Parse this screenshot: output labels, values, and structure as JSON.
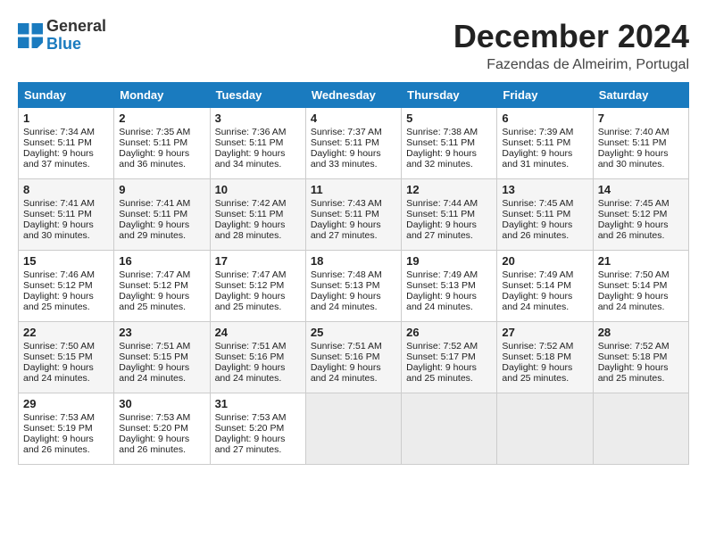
{
  "header": {
    "logo_line1": "General",
    "logo_line2": "Blue",
    "month": "December 2024",
    "location": "Fazendas de Almeirim, Portugal"
  },
  "days_of_week": [
    "Sunday",
    "Monday",
    "Tuesday",
    "Wednesday",
    "Thursday",
    "Friday",
    "Saturday"
  ],
  "weeks": [
    [
      {
        "day": 1,
        "sunrise": "7:34 AM",
        "sunset": "5:11 PM",
        "daylight": "9 hours and 37 minutes."
      },
      {
        "day": 2,
        "sunrise": "7:35 AM",
        "sunset": "5:11 PM",
        "daylight": "9 hours and 36 minutes."
      },
      {
        "day": 3,
        "sunrise": "7:36 AM",
        "sunset": "5:11 PM",
        "daylight": "9 hours and 34 minutes."
      },
      {
        "day": 4,
        "sunrise": "7:37 AM",
        "sunset": "5:11 PM",
        "daylight": "9 hours and 33 minutes."
      },
      {
        "day": 5,
        "sunrise": "7:38 AM",
        "sunset": "5:11 PM",
        "daylight": "9 hours and 32 minutes."
      },
      {
        "day": 6,
        "sunrise": "7:39 AM",
        "sunset": "5:11 PM",
        "daylight": "9 hours and 31 minutes."
      },
      {
        "day": 7,
        "sunrise": "7:40 AM",
        "sunset": "5:11 PM",
        "daylight": "9 hours and 30 minutes."
      }
    ],
    [
      {
        "day": 8,
        "sunrise": "7:41 AM",
        "sunset": "5:11 PM",
        "daylight": "9 hours and 30 minutes."
      },
      {
        "day": 9,
        "sunrise": "7:41 AM",
        "sunset": "5:11 PM",
        "daylight": "9 hours and 29 minutes."
      },
      {
        "day": 10,
        "sunrise": "7:42 AM",
        "sunset": "5:11 PM",
        "daylight": "9 hours and 28 minutes."
      },
      {
        "day": 11,
        "sunrise": "7:43 AM",
        "sunset": "5:11 PM",
        "daylight": "9 hours and 27 minutes."
      },
      {
        "day": 12,
        "sunrise": "7:44 AM",
        "sunset": "5:11 PM",
        "daylight": "9 hours and 27 minutes."
      },
      {
        "day": 13,
        "sunrise": "7:45 AM",
        "sunset": "5:11 PM",
        "daylight": "9 hours and 26 minutes."
      },
      {
        "day": 14,
        "sunrise": "7:45 AM",
        "sunset": "5:12 PM",
        "daylight": "9 hours and 26 minutes."
      }
    ],
    [
      {
        "day": 15,
        "sunrise": "7:46 AM",
        "sunset": "5:12 PM",
        "daylight": "9 hours and 25 minutes."
      },
      {
        "day": 16,
        "sunrise": "7:47 AM",
        "sunset": "5:12 PM",
        "daylight": "9 hours and 25 minutes."
      },
      {
        "day": 17,
        "sunrise": "7:47 AM",
        "sunset": "5:12 PM",
        "daylight": "9 hours and 25 minutes."
      },
      {
        "day": 18,
        "sunrise": "7:48 AM",
        "sunset": "5:13 PM",
        "daylight": "9 hours and 24 minutes."
      },
      {
        "day": 19,
        "sunrise": "7:49 AM",
        "sunset": "5:13 PM",
        "daylight": "9 hours and 24 minutes."
      },
      {
        "day": 20,
        "sunrise": "7:49 AM",
        "sunset": "5:14 PM",
        "daylight": "9 hours and 24 minutes."
      },
      {
        "day": 21,
        "sunrise": "7:50 AM",
        "sunset": "5:14 PM",
        "daylight": "9 hours and 24 minutes."
      }
    ],
    [
      {
        "day": 22,
        "sunrise": "7:50 AM",
        "sunset": "5:15 PM",
        "daylight": "9 hours and 24 minutes."
      },
      {
        "day": 23,
        "sunrise": "7:51 AM",
        "sunset": "5:15 PM",
        "daylight": "9 hours and 24 minutes."
      },
      {
        "day": 24,
        "sunrise": "7:51 AM",
        "sunset": "5:16 PM",
        "daylight": "9 hours and 24 minutes."
      },
      {
        "day": 25,
        "sunrise": "7:51 AM",
        "sunset": "5:16 PM",
        "daylight": "9 hours and 24 minutes."
      },
      {
        "day": 26,
        "sunrise": "7:52 AM",
        "sunset": "5:17 PM",
        "daylight": "9 hours and 25 minutes."
      },
      {
        "day": 27,
        "sunrise": "7:52 AM",
        "sunset": "5:18 PM",
        "daylight": "9 hours and 25 minutes."
      },
      {
        "day": 28,
        "sunrise": "7:52 AM",
        "sunset": "5:18 PM",
        "daylight": "9 hours and 25 minutes."
      }
    ],
    [
      {
        "day": 29,
        "sunrise": "7:53 AM",
        "sunset": "5:19 PM",
        "daylight": "9 hours and 26 minutes."
      },
      {
        "day": 30,
        "sunrise": "7:53 AM",
        "sunset": "5:20 PM",
        "daylight": "9 hours and 26 minutes."
      },
      {
        "day": 31,
        "sunrise": "7:53 AM",
        "sunset": "5:20 PM",
        "daylight": "9 hours and 27 minutes."
      },
      null,
      null,
      null,
      null
    ]
  ]
}
